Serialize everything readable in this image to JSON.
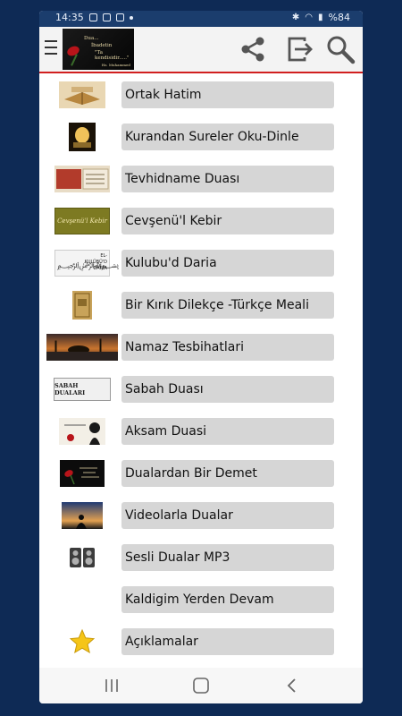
{
  "status": {
    "time": "14:35",
    "battery": "%84"
  },
  "logo": {
    "line1": "Dua...",
    "line2": "İbadetin",
    "line3": "\"Ta kendisidir.....\"",
    "signature": "Hz. Muhammed"
  },
  "items": [
    {
      "label": "Ortak Hatim",
      "icon": "quran-book-icon"
    },
    {
      "label": "Kurandan Sureler Oku-Dinle",
      "icon": "lamp-icon"
    },
    {
      "label": "Tevhidname Duası",
      "icon": "tevhid-book-icon"
    },
    {
      "label": "Cevşenü'l Kebir",
      "icon": "cevsen-cover-icon"
    },
    {
      "label": "Kulubu'd Daria",
      "icon": "calligraphy-icon"
    },
    {
      "label": "Bir Kırık Dilekçe -Türkçe Meali",
      "icon": "book-cover-icon"
    },
    {
      "label": "Namaz Tesbihatlari",
      "icon": "mosque-sunset-icon"
    },
    {
      "label": "Sabah Duası",
      "icon": "sabah-banner-icon"
    },
    {
      "label": "Aksam Duasi",
      "icon": "aksam-icon"
    },
    {
      "label": "Dualardan Bir Demet",
      "icon": "rose-logo-icon"
    },
    {
      "label": "Videolarla Dualar",
      "icon": "video-prayer-icon"
    },
    {
      "label": "Sesli Dualar  MP3",
      "icon": "speakers-icon"
    },
    {
      "label": "Kaldigim Yerden Devam",
      "icon": ""
    },
    {
      "label": "Açıklamalar",
      "icon": "star-icon"
    }
  ],
  "thumb_text": {
    "sabah": "SABAH DUALARI",
    "cevsen": "Cevşenü'l Kebir",
    "kulub": "EL-KULÜBÜ'D DARİA"
  },
  "colors": {
    "accent": "#d11f1f",
    "statusbar": "#1b3d6d",
    "item_bg": "#d6d6d6"
  }
}
